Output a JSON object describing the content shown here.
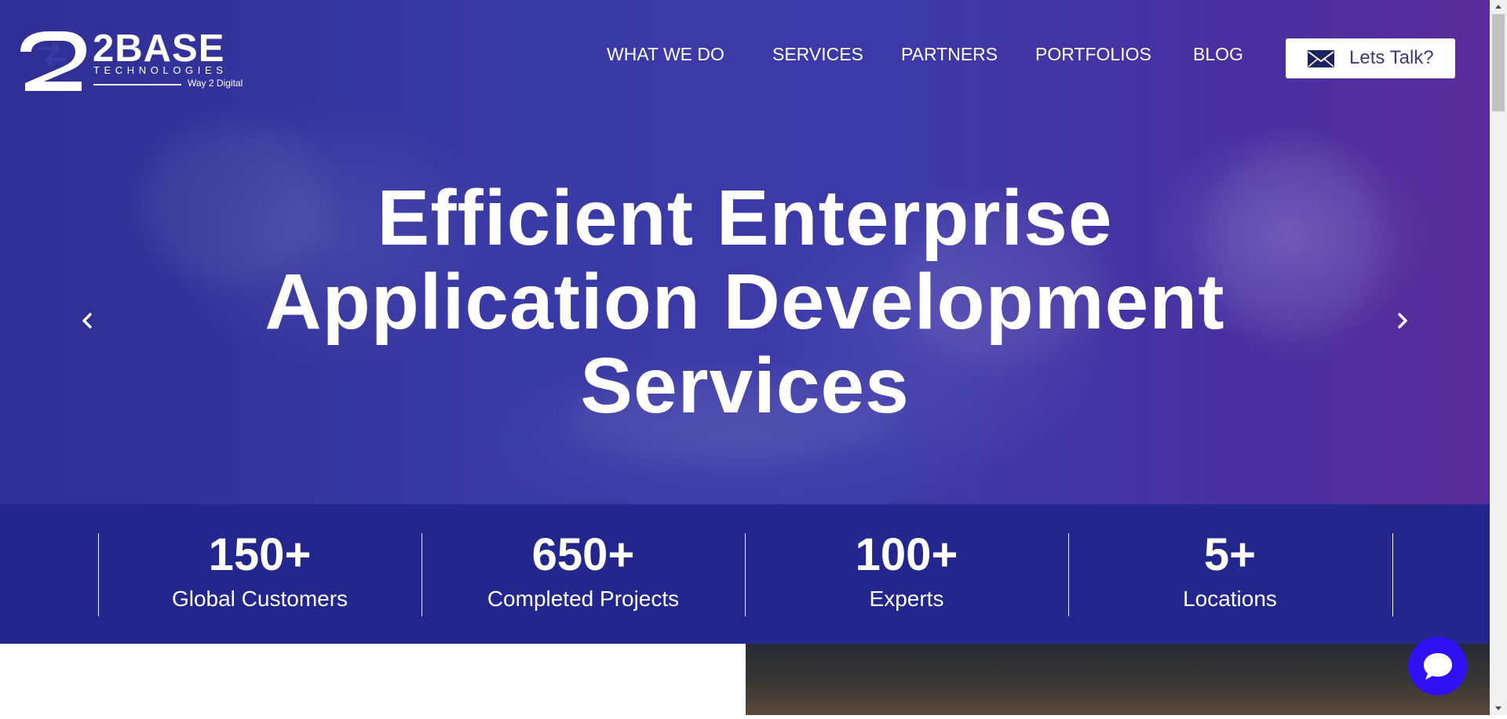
{
  "logo": {
    "wordmark": "2BASE",
    "subtitle": "TECHNOLOGIES",
    "tagline": "Way 2 Digital"
  },
  "nav": {
    "items": [
      {
        "label": "WHAT WE DO"
      },
      {
        "label": "SERVICES"
      },
      {
        "label": "PARTNERS"
      },
      {
        "label": "PORTFOLIOS"
      },
      {
        "label": "BLOG"
      }
    ],
    "cta_label": "Lets Talk?",
    "cta_icon": "mail-icon"
  },
  "hero": {
    "headline_lines": [
      "Efficient Enterprise",
      "Application Development",
      "Services"
    ],
    "prev_icon": "chevron-left-icon",
    "next_icon": "chevron-right-icon"
  },
  "stats": [
    {
      "value": "150+",
      "label": "Global Customers"
    },
    {
      "value": "650+",
      "label": "Completed Projects"
    },
    {
      "value": "100+",
      "label": "Experts"
    },
    {
      "value": "5+",
      "label": "Locations"
    }
  ],
  "chat": {
    "icon": "chat-bubble-icon"
  },
  "colors": {
    "hero_overlay": "#3a3aa6",
    "stats_band": "#22268d",
    "chat_button": "#2f11f3",
    "cta_text": "#3a3b7a"
  }
}
